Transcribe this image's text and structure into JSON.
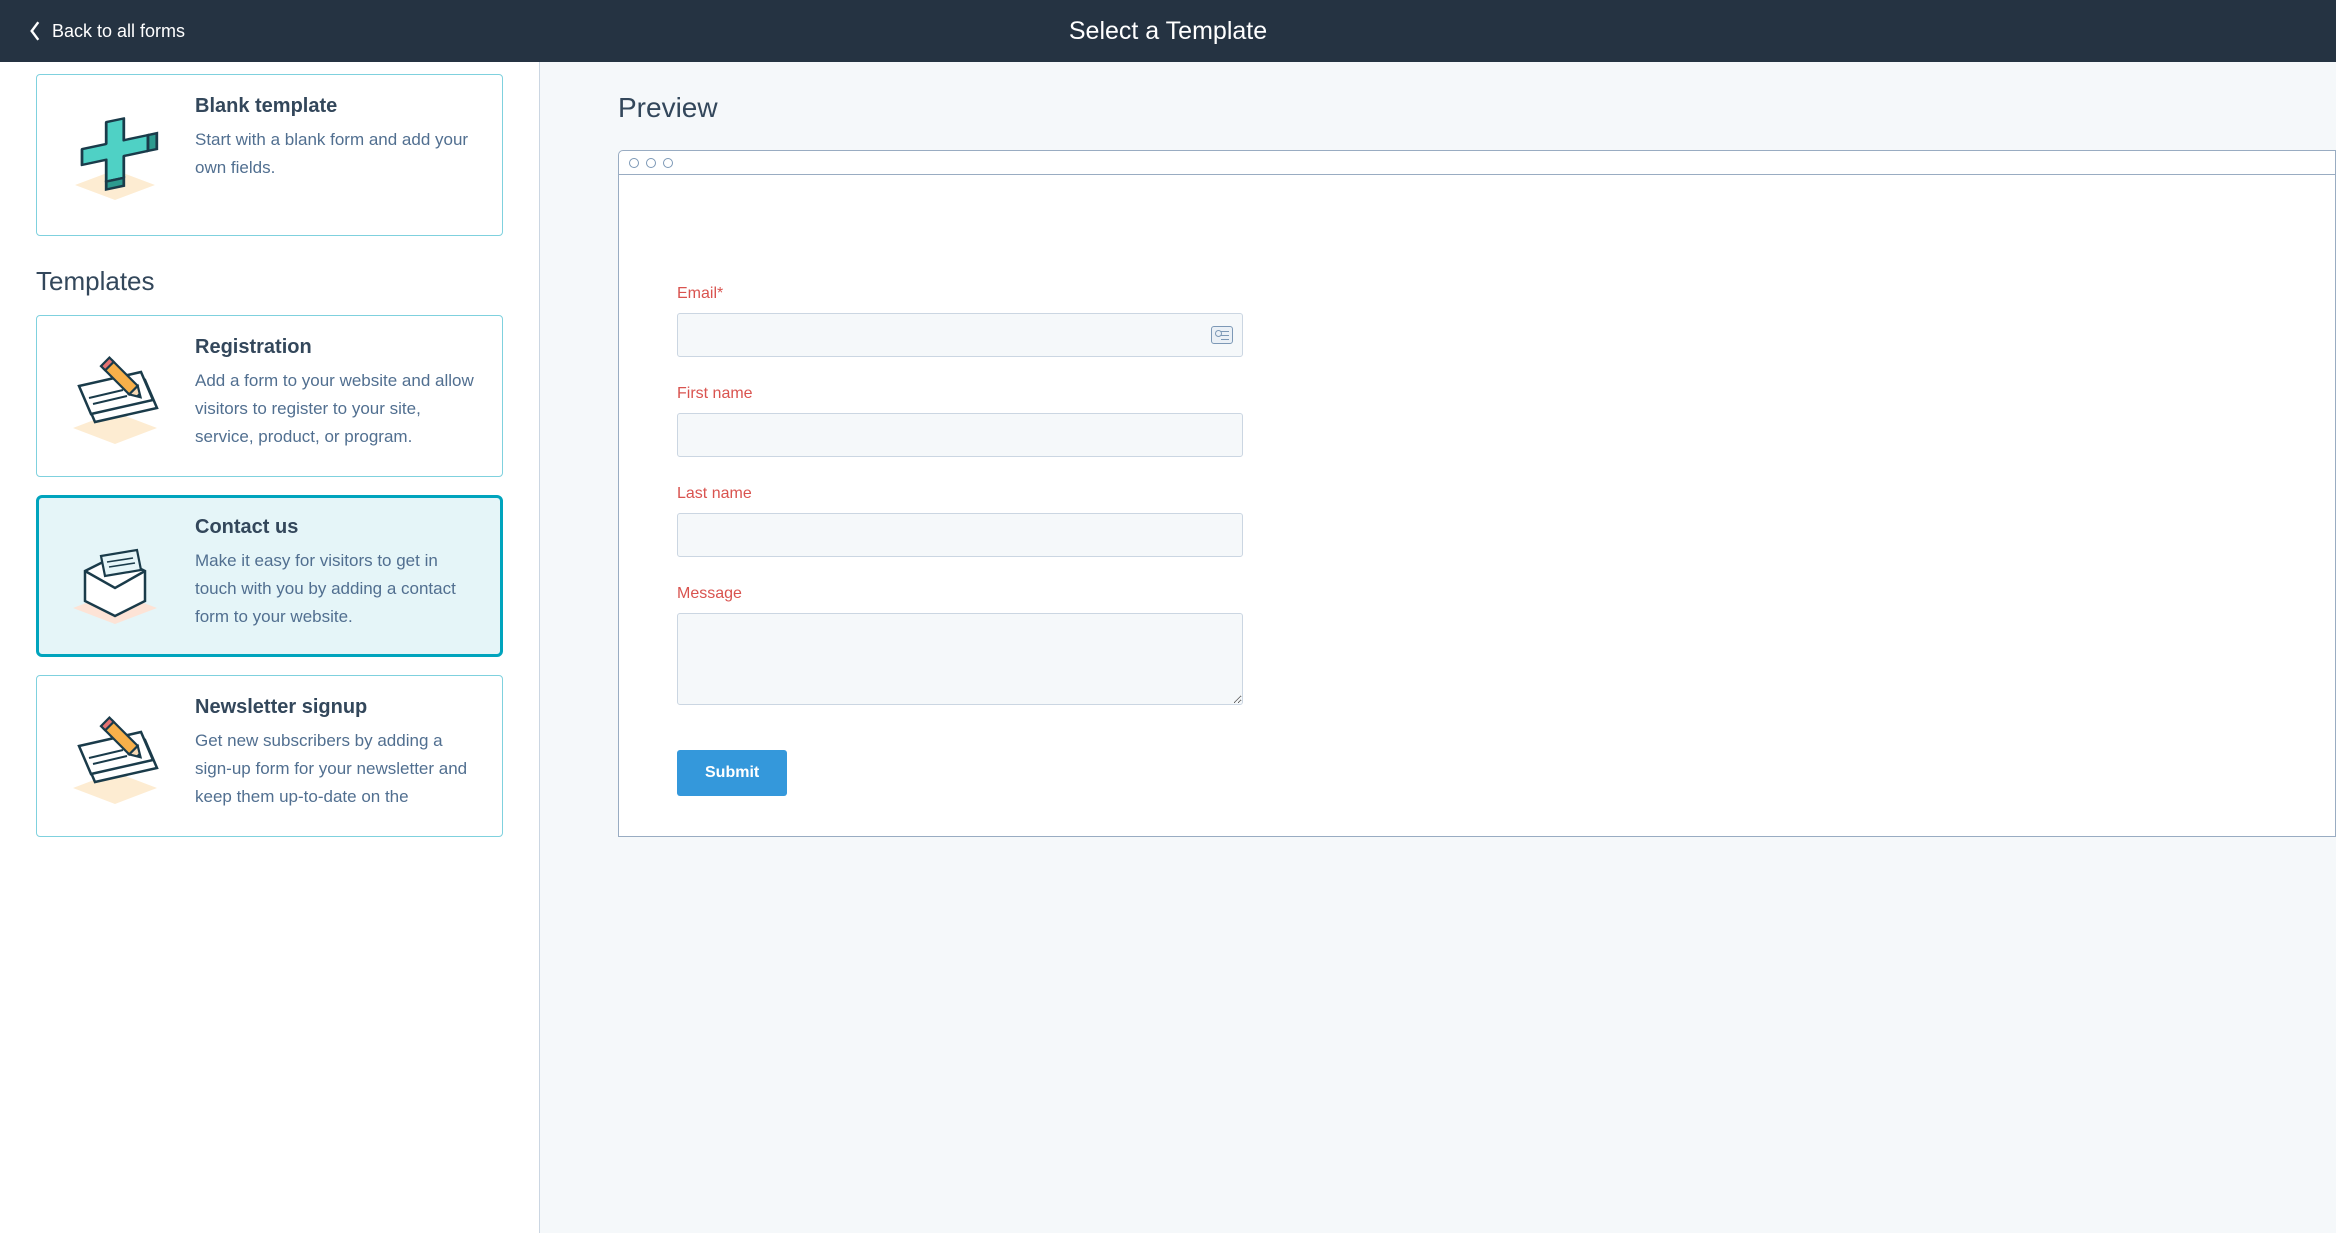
{
  "header": {
    "back_label": "Back to all forms",
    "title": "Select a Template"
  },
  "sidebar": {
    "blank": {
      "title": "Blank template",
      "desc": "Start with a blank form and add your own fields."
    },
    "templates_heading": "Templates",
    "templates": [
      {
        "id": "registration",
        "title": "Registration",
        "desc": "Add a form to your website and allow visitors to register to your site, service, product, or program.",
        "selected": false
      },
      {
        "id": "contact-us",
        "title": "Contact us",
        "desc": "Make it easy for visitors to get in touch with you by adding a contact form to your website.",
        "selected": true
      },
      {
        "id": "newsletter-signup",
        "title": "Newsletter signup",
        "desc": "Get new subscribers by adding a sign-up form for your newsletter and keep them up-to-date on the",
        "selected": false
      }
    ]
  },
  "preview": {
    "heading": "Preview",
    "fields": {
      "email_label": "Email*",
      "first_name_label": "First name",
      "last_name_label": "Last name",
      "message_label": "Message"
    },
    "submit_label": "Submit"
  }
}
